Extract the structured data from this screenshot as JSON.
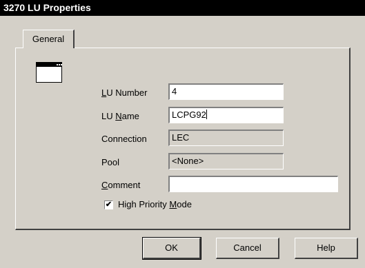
{
  "window": {
    "title": "3270 LU Properties"
  },
  "tabs": [
    {
      "label": "General"
    }
  ],
  "form": {
    "lu_number": {
      "label_prefix": "L",
      "label_rest": "U Number",
      "value": "4"
    },
    "lu_name": {
      "label_prefix": "LU ",
      "label_mnemonic": "N",
      "label_rest": "ame",
      "value": "LCPG92"
    },
    "connection": {
      "label": "Connection",
      "value": "LEC"
    },
    "pool": {
      "label": "Pool",
      "value": "<None>"
    },
    "comment": {
      "label_mnemonic": "C",
      "label_rest": "omment",
      "value": ""
    },
    "high_priority": {
      "label_prefix": "High Priority ",
      "label_mnemonic": "M",
      "label_rest": "ode",
      "checked": true
    }
  },
  "buttons": {
    "ok": "OK",
    "cancel": "Cancel",
    "help": "Help"
  },
  "icons": {
    "page_icon": "window-icon",
    "check_mark": "✔"
  }
}
